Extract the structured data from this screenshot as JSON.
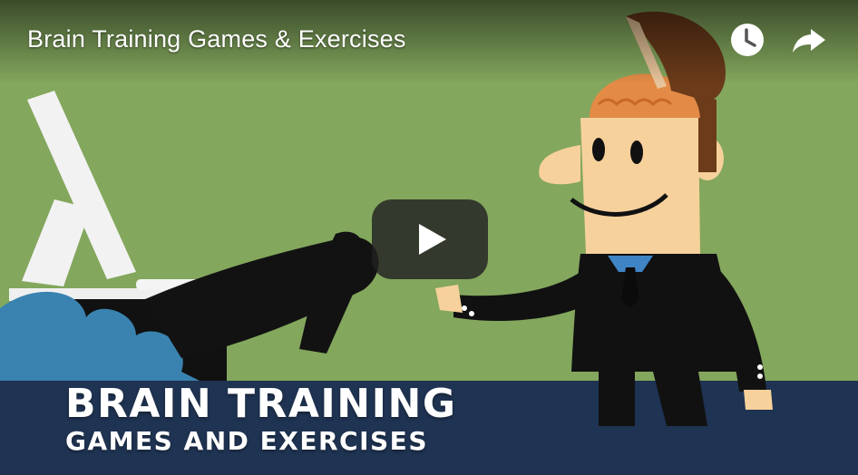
{
  "video": {
    "title": "Brain Training Games & Exercises",
    "overlay_caption": {
      "line1": "BRAIN TRAINING",
      "line2": "GAMES AND EXERCISES"
    }
  },
  "controls": {
    "watch_later_icon": "clock-icon",
    "share_icon": "share-arrow-icon",
    "play_icon": "play-icon"
  },
  "colors": {
    "background_green": "#7fa45a",
    "footer_navy": "#1f3352",
    "play_button_bg": "#212121"
  }
}
